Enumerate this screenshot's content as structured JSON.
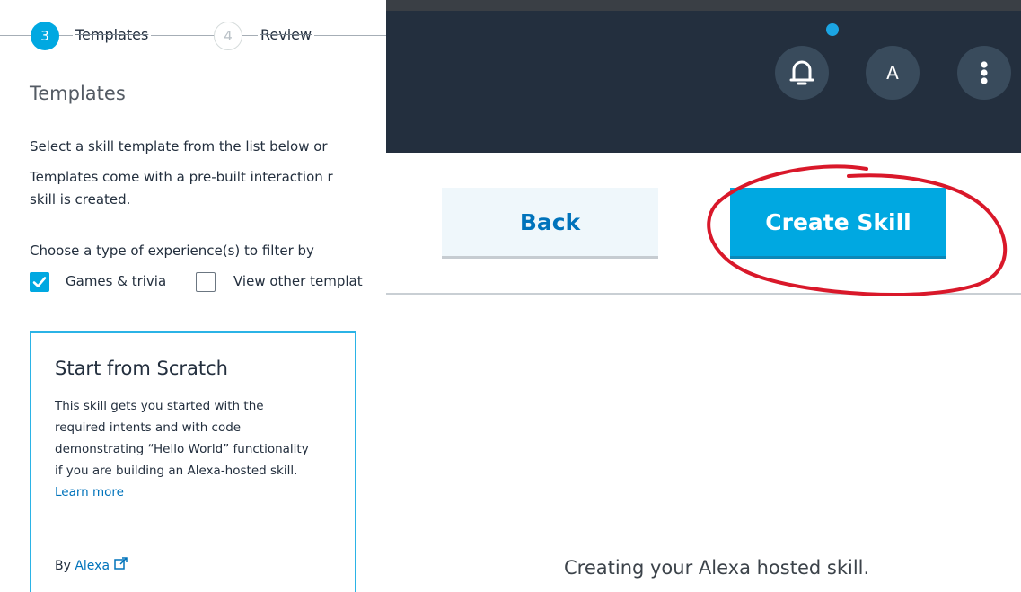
{
  "stepper": {
    "steps": [
      {
        "number": "3",
        "label": "Templates"
      },
      {
        "number": "4",
        "label": "Review"
      }
    ]
  },
  "templates": {
    "title": "Templates",
    "description_lines": [
      "Select a skill template from the list below or",
      "Templates come with a pre-built interaction r",
      "skill is created."
    ],
    "filter_label": "Choose a type of experience(s) to filter by",
    "filters": [
      {
        "label": "Games & trivia",
        "checked": true
      },
      {
        "label": "View other templat",
        "checked": false
      }
    ],
    "card": {
      "title": "Start from Scratch",
      "lines": [
        "This skill gets you started with the",
        "required intents and with code",
        "demonstrating “Hello World” functionality",
        "if you are building an Alexa-hosted skill."
      ],
      "learn_more": "Learn more",
      "by_prefix": "By",
      "by_link": "Alexa"
    }
  },
  "header": {
    "avatar_letter": "A",
    "icons": [
      "bell-icon",
      "avatar",
      "more-vertical-icon"
    ]
  },
  "actions": {
    "back_label": "Back",
    "create_label": "Create Skill"
  },
  "status": {
    "message": "Creating your Alexa hosted skill."
  },
  "colors": {
    "accent": "#00a8e1",
    "header_bg": "#232f3e",
    "link": "#0073bb",
    "annotation": "#d9182a"
  }
}
